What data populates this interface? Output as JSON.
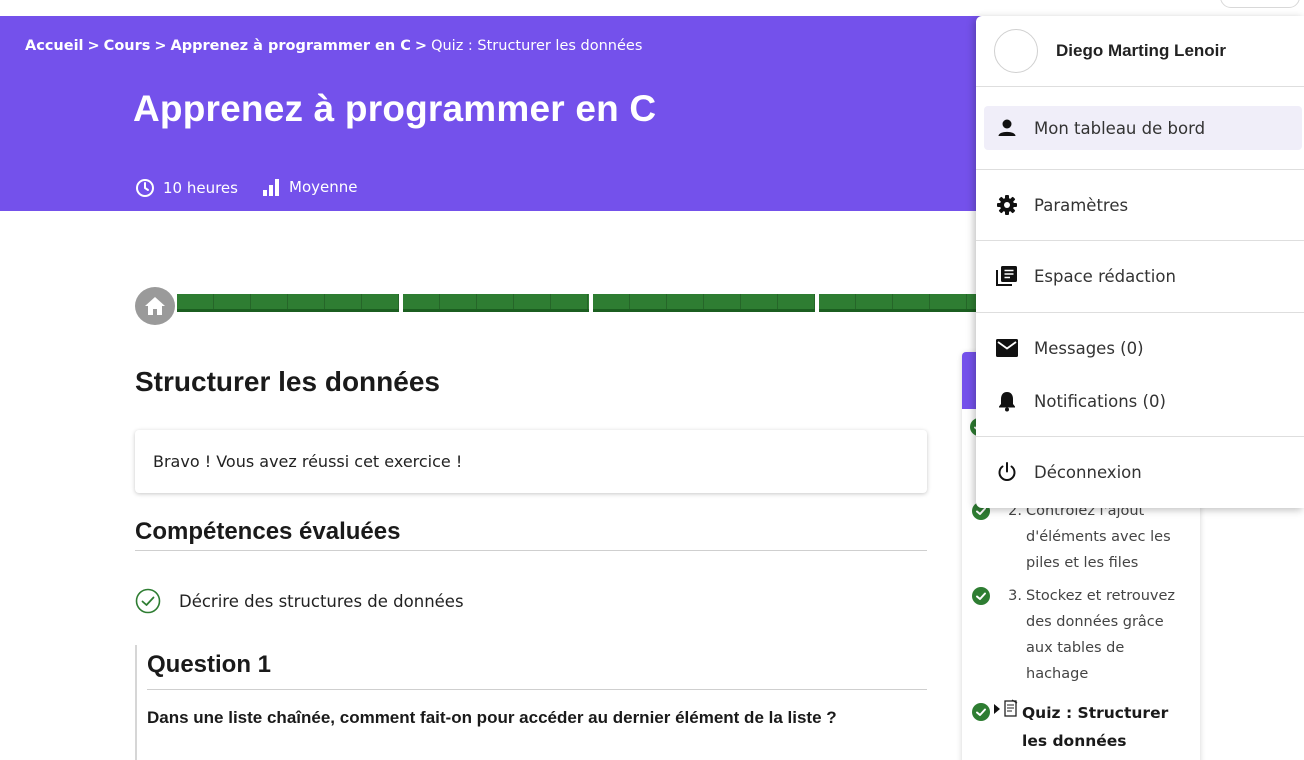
{
  "breadcrumb": {
    "home": "Accueil",
    "courses": "Cours",
    "course": "Apprenez à programmer en C",
    "current": "Quiz : Structurer les données",
    "separator": ">"
  },
  "course": {
    "title": "Apprenez à programmer en C",
    "duration": "10 heures",
    "level": "Moyenne"
  },
  "progress": {
    "segments": 4
  },
  "main": {
    "section_title": "Structurer les données",
    "success_message": "Bravo ! Vous avez réussi cet exercice !",
    "competences_title": "Compétences évaluées",
    "competence": "Décrire des structures de données",
    "question_title": "Question 1",
    "question_text": "Dans une liste chaînée, comment fait-on pour accéder au dernier élément de la liste ?"
  },
  "sidebar": {
    "items": [
      {
        "num": "2.",
        "label": "Contrôlez l'ajout d'éléments avec les piles et les files",
        "done": true
      },
      {
        "num": "3.",
        "label": "Stockez et retrouvez des données grâce aux tables de hachage",
        "done": true
      },
      {
        "num": "",
        "label": "Quiz : Structurer les données",
        "done": true,
        "current": true
      }
    ]
  },
  "user_menu": {
    "name": "Diego Marting Lenoir",
    "items": {
      "dashboard": "Mon tableau de bord",
      "settings": "Paramètres",
      "writing": "Espace rédaction",
      "messages": "Messages (0)",
      "notifications": "Notifications (0)",
      "logout": "Déconnexion"
    }
  },
  "colors": {
    "accent": "#7451eb",
    "success": "#2e7d32",
    "check": "#2e7d32"
  }
}
